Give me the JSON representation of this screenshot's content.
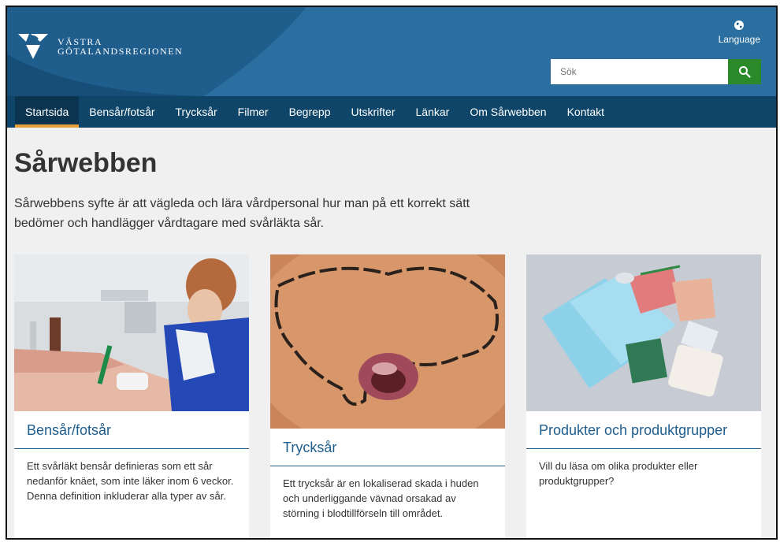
{
  "header": {
    "logo_line1": "VÄSTRA",
    "logo_line2": "GÖTALANDSREGIONEN",
    "language_label": "Language",
    "search_placeholder": "Sök"
  },
  "nav": {
    "items": [
      "Startsida",
      "Bensår/fotsår",
      "Trycksår",
      "Filmer",
      "Begrepp",
      "Utskrifter",
      "Länkar",
      "Om Sårwebben",
      "Kontakt"
    ],
    "active": "Startsida"
  },
  "main": {
    "title": "Sårwebben",
    "intro": "Sårwebbens syfte är att vägleda och lära vårdpersonal hur man på ett korrekt sätt bedömer och handlägger vårdtagare med svårläkta sår.",
    "cards": [
      {
        "title": "Bensår/fotsår",
        "text": "Ett svårläkt bensår definieras som ett sår nedanför knäet, som inte läker inom 6 veckor. Denna definition inkluderar alla typer av sår."
      },
      {
        "title": "Trycksår",
        "text": "Ett trycksår är en lokaliserad skada i huden och underliggande vävnad orsakad av störning i blodtillförseln till området."
      },
      {
        "title": "Produkter och produktgrupper",
        "text": "Vill du läsa om olika produkter eller produktgrupper?"
      }
    ]
  },
  "colors": {
    "header_blue": "#1f5d8c",
    "nav_blue": "#0e4568",
    "accent_orange": "#e8a13a",
    "search_green": "#2a8a2a"
  }
}
